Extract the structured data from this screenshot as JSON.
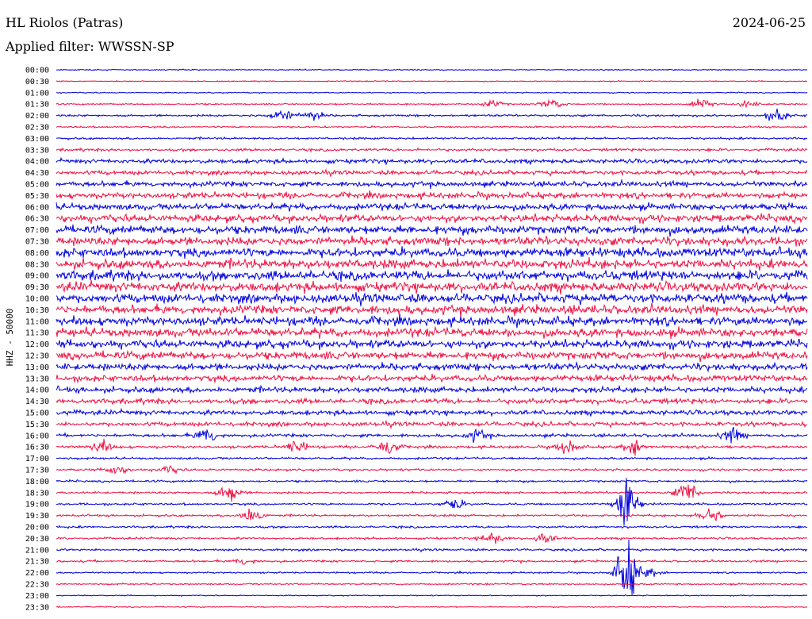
{
  "header": {
    "station": "HL Riolos (Patras)",
    "date": "2024-06-25",
    "filter": "Applied filter: WWSSN-SP"
  },
  "chart_data": {
    "type": "line",
    "title": "HL Riolos (Patras)",
    "date": "2024-06-25",
    "subtitle": "Applied filter: WWSSN-SP",
    "ylabel": "HHZ - 50000",
    "colors": {
      "even": "#0000dd",
      "odd": "#ee1144"
    },
    "trace_labels": [
      "00:00",
      "00:30",
      "01:00",
      "01:30",
      "02:00",
      "02:30",
      "03:00",
      "03:30",
      "04:00",
      "04:30",
      "05:00",
      "05:30",
      "06:00",
      "06:30",
      "07:00",
      "07:30",
      "08:00",
      "08:30",
      "09:00",
      "09:30",
      "10:00",
      "10:30",
      "11:00",
      "11:30",
      "12:00",
      "12:30",
      "13:00",
      "13:30",
      "14:00",
      "14:30",
      "15:00",
      "15:30",
      "16:00",
      "16:30",
      "17:00",
      "17:30",
      "18:00",
      "18:30",
      "19:00",
      "19:30",
      "20:00",
      "20:30",
      "21:00",
      "21:30",
      "22:00",
      "22:30",
      "23:00",
      "23:30"
    ],
    "noise_amplitude": [
      1,
      1,
      1,
      1.5,
      2,
      1.5,
      2,
      2.5,
      4,
      4,
      5,
      5.5,
      6,
      7,
      8,
      8,
      8.5,
      9,
      9,
      9,
      8.5,
      8.5,
      8,
      8,
      7.5,
      7.5,
      6.5,
      6,
      5.5,
      5,
      4.5,
      4,
      3,
      2.5,
      2,
      2,
      2,
      2,
      2,
      2,
      2,
      2,
      2,
      2,
      1.5,
      1.5,
      1,
      1
    ],
    "events": [
      {
        "trace": "02:00",
        "t": 0.3,
        "amp": 14
      },
      {
        "trace": "02:00",
        "t": 0.34,
        "amp": 10
      },
      {
        "trace": "02:00",
        "t": 0.96,
        "amp": 12
      },
      {
        "trace": "01:30",
        "t": 0.58,
        "amp": 7
      },
      {
        "trace": "01:30",
        "t": 0.66,
        "amp": 9
      },
      {
        "trace": "01:30",
        "t": 0.86,
        "amp": 9
      },
      {
        "trace": "01:30",
        "t": 0.92,
        "amp": 7
      },
      {
        "trace": "16:00",
        "t": 0.2,
        "amp": 16
      },
      {
        "trace": "16:00",
        "t": 0.56,
        "amp": 10
      },
      {
        "trace": "16:00",
        "t": 0.9,
        "amp": 14
      },
      {
        "trace": "16:30",
        "t": 0.06,
        "amp": 12
      },
      {
        "trace": "16:30",
        "t": 0.32,
        "amp": 14
      },
      {
        "trace": "16:30",
        "t": 0.44,
        "amp": 18
      },
      {
        "trace": "16:30",
        "t": 0.68,
        "amp": 14
      },
      {
        "trace": "16:30",
        "t": 0.77,
        "amp": 14
      },
      {
        "trace": "17:30",
        "t": 0.08,
        "amp": 10
      },
      {
        "trace": "17:30",
        "t": 0.15,
        "amp": 8
      },
      {
        "trace": "18:30",
        "t": 0.23,
        "amp": 18
      },
      {
        "trace": "18:30",
        "t": 0.84,
        "amp": 22
      },
      {
        "trace": "19:00",
        "t": 0.53,
        "amp": 10
      },
      {
        "trace": "19:00",
        "t": 0.76,
        "amp": 50
      },
      {
        "trace": "19:30",
        "t": 0.26,
        "amp": 20
      },
      {
        "trace": "19:30",
        "t": 0.87,
        "amp": 18
      },
      {
        "trace": "20:30",
        "t": 0.58,
        "amp": 12
      },
      {
        "trace": "20:30",
        "t": 0.65,
        "amp": 10
      },
      {
        "trace": "21:30",
        "t": 0.25,
        "amp": 7
      },
      {
        "trace": "22:00",
        "t": 0.76,
        "amp": 60
      },
      {
        "trace": "22:00",
        "t": 0.79,
        "amp": 8
      }
    ]
  }
}
